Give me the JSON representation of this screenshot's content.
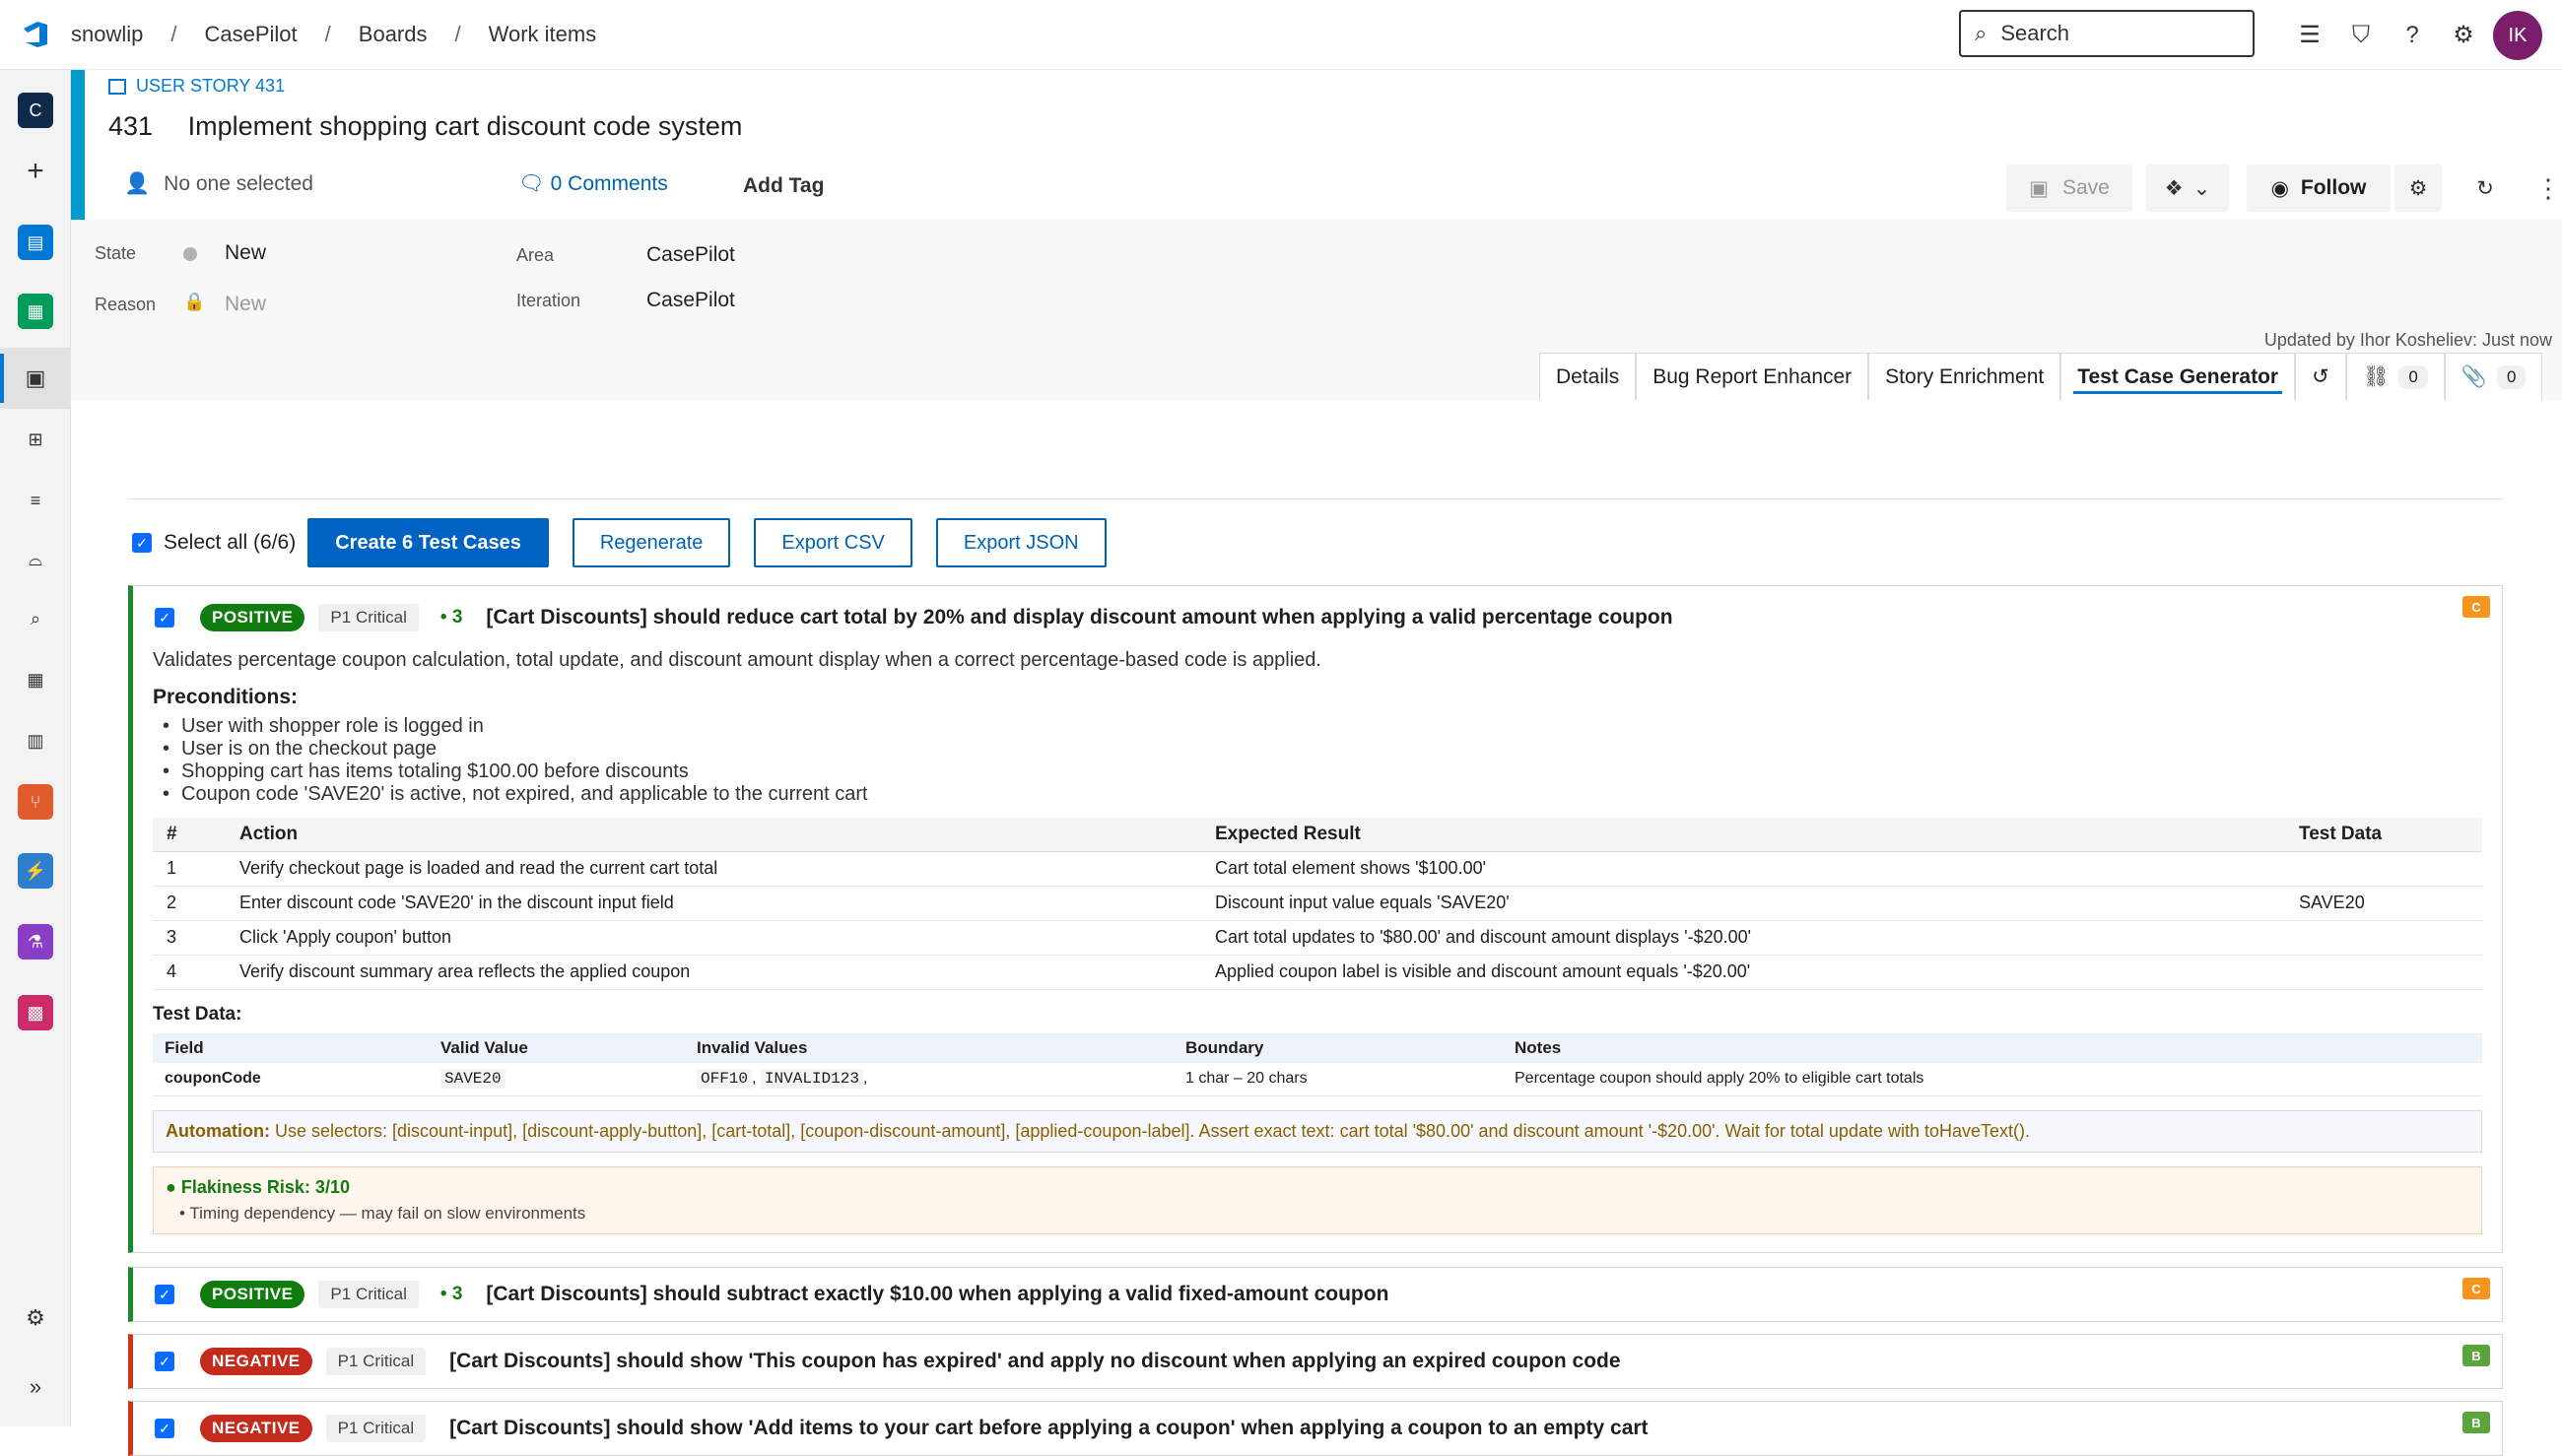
{
  "topbar": {
    "breadcrumbs": [
      "snowlip",
      "CasePilot",
      "Boards",
      "Work items"
    ],
    "search_placeholder": "Search",
    "avatar_initials": "IK"
  },
  "leftnav": {
    "project_initial": "C"
  },
  "work_item": {
    "type_label": "USER STORY 431",
    "id": "431",
    "title": "Implement shopping cart discount code system",
    "assignee": "No one selected",
    "comments": "0 Comments",
    "add_tag": "Add Tag",
    "save": "Save",
    "follow": "Follow"
  },
  "fields": {
    "state_label": "State",
    "state_value": "New",
    "reason_label": "Reason",
    "reason_value": "New",
    "area_label": "Area",
    "area_value": "CasePilot",
    "iteration_label": "Iteration",
    "iteration_value": "CasePilot"
  },
  "updated": "Updated by Ihor Kosheliev: Just now",
  "tabs": {
    "details": "Details",
    "bug": "Bug Report Enhancer",
    "story": "Story Enrichment",
    "tcg": "Test Case Generator",
    "links_count": "0",
    "attach_count": "0"
  },
  "toolbar": {
    "select_all": "Select all (6/6)",
    "create": "Create 6 Test Cases",
    "regenerate": "Regenerate",
    "export_csv": "Export CSV",
    "export_json": "Export JSON"
  },
  "card1": {
    "badge": "POSITIVE",
    "priority": "P1 Critical",
    "steps": "• 3",
    "title": "[Cart Discounts] should reduce cart total by 20% and display discount amount when applying a valid percentage coupon",
    "grade": "C",
    "description": "Validates percentage coupon calculation, total update, and discount amount display when a correct percentage-based code is applied.",
    "preconditions_heading": "Preconditions:",
    "preconditions": [
      "User with shopper role is logged in",
      "User is on the checkout page",
      "Shopping cart has items totaling $100.00 before discounts",
      "Coupon code 'SAVE20' is active, not expired, and applicable to the current cart"
    ],
    "steps_headers": [
      "#",
      "Action",
      "Expected Result",
      "Test Data"
    ],
    "steps_rows": [
      [
        "1",
        "Verify checkout page is loaded and read the current cart total",
        "Cart total element shows '$100.00'",
        ""
      ],
      [
        "2",
        "Enter discount code 'SAVE20' in the discount input field",
        "Discount input value equals 'SAVE20'",
        "SAVE20"
      ],
      [
        "3",
        "Click 'Apply coupon' button",
        "Cart total updates to '$80.00' and discount amount displays '-$20.00'",
        ""
      ],
      [
        "4",
        "Verify discount summary area reflects the applied coupon",
        "Applied coupon label is visible and discount amount equals '-$20.00'",
        ""
      ]
    ],
    "test_data_heading": "Test Data:",
    "td_headers": [
      "Field",
      "Valid Value",
      "Invalid Values",
      "Boundary",
      "Notes"
    ],
    "td_row": {
      "field": "couponCode",
      "valid": "SAVE20",
      "invalid1": "OFF10",
      "invalid2": "INVALID123",
      "boundary": "1 char – 20 chars",
      "notes": "Percentage coupon should apply 20% to eligible cart totals"
    },
    "automation_label": "Automation:",
    "automation_text": "Use selectors: [discount-input], [discount-apply-button], [cart-total], [coupon-discount-amount], [applied-coupon-label]. Assert exact text: cart total '$80.00' and discount amount '-$20.00'. Wait for total update with toHaveText().",
    "flaky_heading": "● Flakiness Risk: 3/10",
    "flaky_item": "Timing dependency — may fail on slow environments"
  },
  "card2": {
    "badge": "POSITIVE",
    "priority": "P1 Critical",
    "steps": "• 3",
    "title": "[Cart Discounts] should subtract exactly $10.00 when applying a valid fixed-amount coupon",
    "grade": "C"
  },
  "card3": {
    "badge": "NEGATIVE",
    "priority": "P1 Critical",
    "title": "[Cart Discounts] should show 'This coupon has expired' and apply no discount when applying an expired coupon code",
    "grade": "B"
  },
  "card4": {
    "badge": "NEGATIVE",
    "priority": "P1 Critical",
    "title": "[Cart Discounts] should show 'Add items to your cart before applying a coupon' when applying a coupon to an empty cart",
    "grade": "B"
  }
}
